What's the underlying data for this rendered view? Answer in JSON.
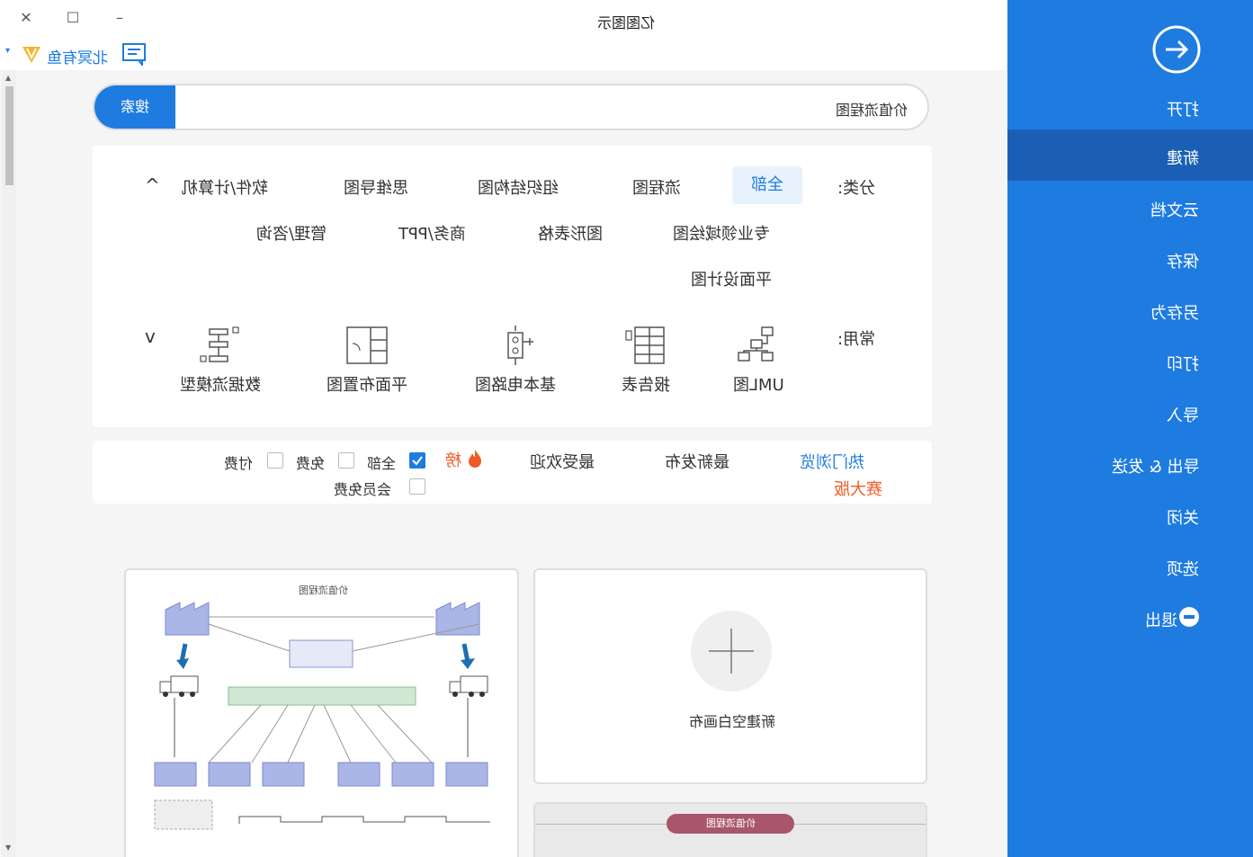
{
  "app": {
    "title": "亿图图示"
  },
  "window_controls": {
    "close": "✕",
    "maximize": "☐",
    "minimize": "–"
  },
  "user": {
    "name": "北冥有鱼",
    "caret": "▾"
  },
  "search": {
    "button": "搜索",
    "value": "价值流程图"
  },
  "categories": {
    "label": "分类:",
    "items": [
      "全部",
      "流程图",
      "组织结构图",
      "思维导图",
      "软件/计算机",
      "专业领域绘图",
      "图形表格",
      "商务/PPT",
      "管理/咨询",
      "平面设计图"
    ],
    "active_index": 0,
    "collapse_glyph": "^"
  },
  "common": {
    "label": "常用:",
    "items": [
      "UML图",
      "报告表",
      "基本电路图",
      "平面布置图",
      "数据流模型"
    ],
    "expand_glyph": "v"
  },
  "filter": {
    "tabs": [
      "热门浏览",
      "最新发布",
      "最受欢迎"
    ],
    "hot_label": "榜",
    "contest_label": "赛大版",
    "checkboxes": [
      {
        "label": "全部",
        "checked": true
      },
      {
        "label": "免费",
        "checked": false
      },
      {
        "label": "付费",
        "checked": false
      },
      {
        "label": "会员免费",
        "checked": false
      }
    ]
  },
  "cards": {
    "template_title": "价值流程图",
    "new_canvas_label": "新建空白画布",
    "second_template_title": "价值流程图"
  },
  "sidebar": {
    "items": [
      "打开",
      "新建",
      "云文档",
      "保存",
      "另存为",
      "打印",
      "导入",
      "导出 & 发送",
      "关闭",
      "选项",
      "退出"
    ],
    "selected_index": 1
  },
  "colors": {
    "accent": "#1e7be0",
    "sidebar_selected": "#1a5fb5",
    "contest": "#f05a28",
    "hot": "#f05a28"
  }
}
